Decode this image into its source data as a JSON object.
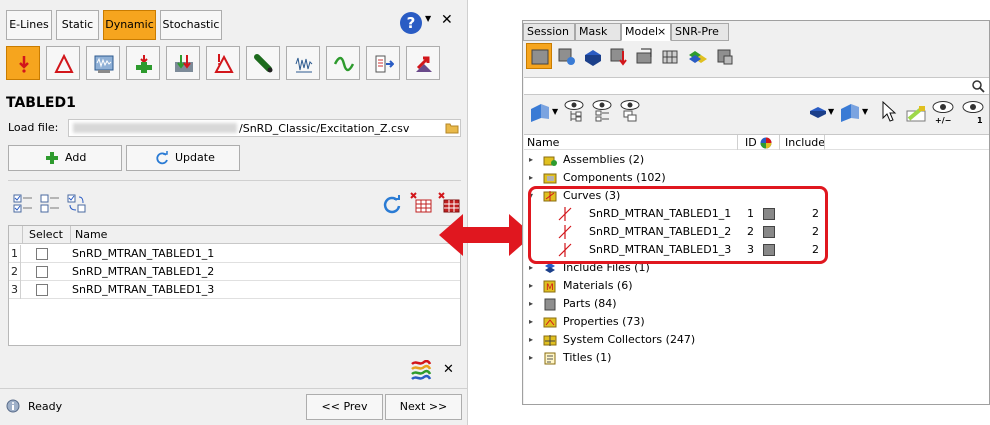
{
  "left": {
    "tabs": [
      "E-Lines",
      "Static",
      "Dynamic",
      "Stochastic"
    ],
    "active_tab": "Dynamic",
    "title": "TABLED1",
    "load_file_label": "Load file:",
    "load_file_value": "/SnRD_Classic/Excitation_Z.csv",
    "add_label": "Add",
    "update_label": "Update",
    "grid": {
      "columns": [
        "Select",
        "Name"
      ],
      "rows": [
        {
          "num": "1",
          "name": "SnRD_MTRAN_TABLED1_1"
        },
        {
          "num": "2",
          "name": "SnRD_MTRAN_TABLED1_2"
        },
        {
          "num": "3",
          "name": "SnRD_MTRAN_TABLED1_3"
        }
      ]
    },
    "status": "Ready",
    "prev_label": "<<  Prev",
    "next_label": "Next  >>"
  },
  "right": {
    "tabs": [
      "Session",
      "Mask",
      "Model",
      "SNR-Pre"
    ],
    "active_tab": "Model",
    "tab_close": "×",
    "header": {
      "name": "Name",
      "id": "ID",
      "include": "Include"
    },
    "eye_labels": {
      "plusminus": "+/−",
      "one": "1"
    },
    "tree": [
      {
        "label": "Assemblies (2)"
      },
      {
        "label": "Components (102)"
      },
      {
        "label": "Curves (3)"
      },
      {
        "label": "Include Files (1)"
      },
      {
        "label": "Materials (6)"
      },
      {
        "label": "Parts (84)"
      },
      {
        "label": "Properties (73)"
      },
      {
        "label": "System Collectors (247)"
      },
      {
        "label": "Titles (1)"
      }
    ],
    "curves": [
      {
        "name": "SnRD_MTRAN_TABLED1_1",
        "id": "1",
        "include": "2"
      },
      {
        "name": "SnRD_MTRAN_TABLED1_2",
        "id": "2",
        "include": "2"
      },
      {
        "name": "SnRD_MTRAN_TABLED1_3",
        "id": "3",
        "include": "2"
      }
    ]
  },
  "colors": {
    "accent": "#f6a51e",
    "highlight": "#e0171f",
    "arrow": "#e0171f"
  }
}
